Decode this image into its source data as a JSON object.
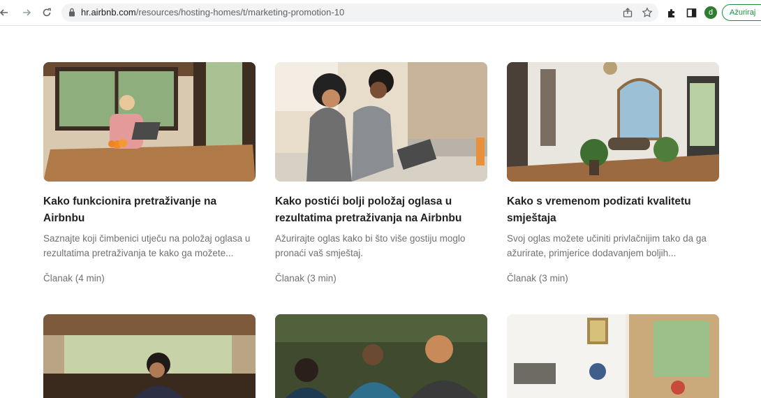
{
  "browser": {
    "url_host": "hr.airbnb.com",
    "url_path": "/resources/hosting-homes/t/marketing-promotion-10",
    "profile_initial": "d",
    "update_button": "Ažuriraj"
  },
  "articles": [
    {
      "title": "Kako funkcionira pretraživanje na Airbnbu",
      "description": "Saznajte koji čimbenici utječu na položaj oglasa u rezultatima pretraživanja te kako ga možete...",
      "meta": "Članak (4 min)"
    },
    {
      "title": "Kako postići bolji položaj oglasa u rezultatima pretraživanja na Airbnbu",
      "description": "Ažurirajte oglas kako bi što više gostiju moglo pronaći vaš smještaj.",
      "meta": "Članak (3 min)"
    },
    {
      "title": "Kako s vremenom podizati kvalitetu smještaja",
      "description": "Svoj oglas možete učiniti privlačnijim tako da ga ažurirate, primjerice dodavanjem boljih...",
      "meta": "Članak (3 min)"
    }
  ],
  "icons": {
    "back": "back-arrow-icon",
    "forward": "forward-arrow-icon",
    "reload": "reload-icon",
    "lock": "lock-icon",
    "share": "share-icon",
    "bookmark": "star-icon",
    "extensions": "puzzle-icon",
    "sidepanel": "side-panel-icon"
  }
}
